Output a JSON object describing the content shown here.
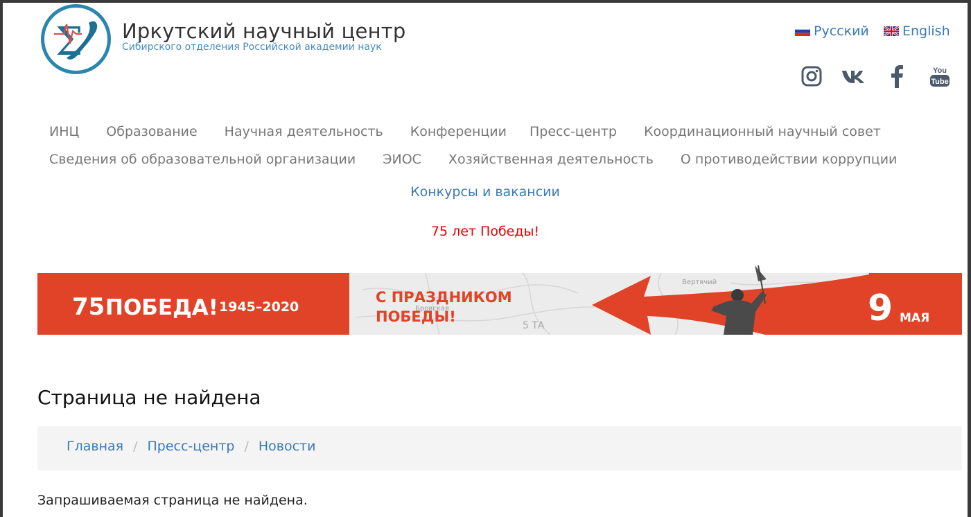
{
  "header": {
    "title": "Иркутский научный центр",
    "subtitle": "Сибирского отделения Российской академии наук"
  },
  "languages": {
    "ru": "Русский",
    "en": "English"
  },
  "social": {
    "youtube_top": "You",
    "youtube_bottom": "Tube"
  },
  "nav": {
    "row1": [
      "ИНЦ",
      "Образование",
      "Научная деятельность",
      "Конференции",
      "Пресс-центр",
      "Координационный научный совет"
    ],
    "row2": [
      "Сведения об образовательной организации",
      "ЭИОС",
      "Хозяйственная деятельность",
      "О противодействии коррупции"
    ],
    "contests": "Конкурсы и вакансии",
    "victory": "75 лет Победы!"
  },
  "banner": {
    "logo_num": "75",
    "logo_word": "ПОБЕДА!",
    "years": "1945–2020",
    "greeting_line1": "С ПРАЗДНИКОМ",
    "greeting_line2": "ПОБЕДЫ!",
    "day": "9",
    "month": "МАЯ",
    "map_label1": "Вертячий",
    "map_label2": "5 ТА",
    "map_label3": "Бровская",
    "colors": {
      "red": "#e04327",
      "map_bg": "#ececec"
    }
  },
  "content": {
    "page_title": "Страница не найдена",
    "breadcrumb": [
      "Главная",
      "Пресс-центр",
      "Новости"
    ],
    "breadcrumb_sep": "/",
    "message": "Запрашиваемая страница не найдена."
  }
}
